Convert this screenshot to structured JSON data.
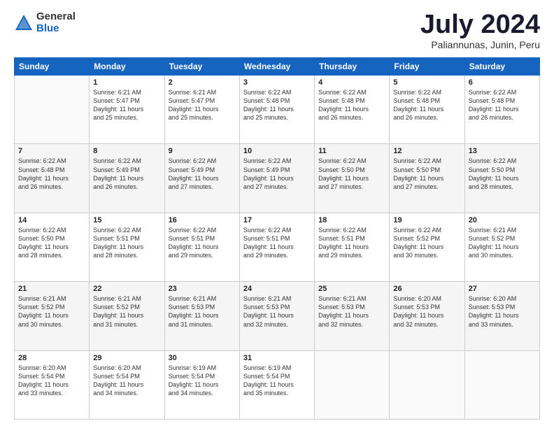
{
  "header": {
    "logo_general": "General",
    "logo_blue": "Blue",
    "month_title": "July 2024",
    "subtitle": "Paliannunas, Junin, Peru"
  },
  "days_of_week": [
    "Sunday",
    "Monday",
    "Tuesday",
    "Wednesday",
    "Thursday",
    "Friday",
    "Saturday"
  ],
  "weeks": [
    [
      {
        "day": "",
        "info": ""
      },
      {
        "day": "1",
        "info": "Sunrise: 6:21 AM\nSunset: 5:47 PM\nDaylight: 11 hours\nand 25 minutes."
      },
      {
        "day": "2",
        "info": "Sunrise: 6:21 AM\nSunset: 5:47 PM\nDaylight: 11 hours\nand 25 minutes."
      },
      {
        "day": "3",
        "info": "Sunrise: 6:22 AM\nSunset: 5:48 PM\nDaylight: 11 hours\nand 25 minutes."
      },
      {
        "day": "4",
        "info": "Sunrise: 6:22 AM\nSunset: 5:48 PM\nDaylight: 11 hours\nand 26 minutes."
      },
      {
        "day": "5",
        "info": "Sunrise: 6:22 AM\nSunset: 5:48 PM\nDaylight: 11 hours\nand 26 minutes."
      },
      {
        "day": "6",
        "info": "Sunrise: 6:22 AM\nSunset: 5:48 PM\nDaylight: 11 hours\nand 26 minutes."
      }
    ],
    [
      {
        "day": "7",
        "info": "Sunrise: 6:22 AM\nSunset: 5:48 PM\nDaylight: 11 hours\nand 26 minutes."
      },
      {
        "day": "8",
        "info": "Sunrise: 6:22 AM\nSunset: 5:49 PM\nDaylight: 11 hours\nand 26 minutes."
      },
      {
        "day": "9",
        "info": "Sunrise: 6:22 AM\nSunset: 5:49 PM\nDaylight: 11 hours\nand 27 minutes."
      },
      {
        "day": "10",
        "info": "Sunrise: 6:22 AM\nSunset: 5:49 PM\nDaylight: 11 hours\nand 27 minutes."
      },
      {
        "day": "11",
        "info": "Sunrise: 6:22 AM\nSunset: 5:50 PM\nDaylight: 11 hours\nand 27 minutes."
      },
      {
        "day": "12",
        "info": "Sunrise: 6:22 AM\nSunset: 5:50 PM\nDaylight: 11 hours\nand 27 minutes."
      },
      {
        "day": "13",
        "info": "Sunrise: 6:22 AM\nSunset: 5:50 PM\nDaylight: 11 hours\nand 28 minutes."
      }
    ],
    [
      {
        "day": "14",
        "info": "Sunrise: 6:22 AM\nSunset: 5:50 PM\nDaylight: 11 hours\nand 28 minutes."
      },
      {
        "day": "15",
        "info": "Sunrise: 6:22 AM\nSunset: 5:51 PM\nDaylight: 11 hours\nand 28 minutes."
      },
      {
        "day": "16",
        "info": "Sunrise: 6:22 AM\nSunset: 5:51 PM\nDaylight: 11 hours\nand 29 minutes."
      },
      {
        "day": "17",
        "info": "Sunrise: 6:22 AM\nSunset: 5:51 PM\nDaylight: 11 hours\nand 29 minutes."
      },
      {
        "day": "18",
        "info": "Sunrise: 6:22 AM\nSunset: 5:51 PM\nDaylight: 11 hours\nand 29 minutes."
      },
      {
        "day": "19",
        "info": "Sunrise: 6:22 AM\nSunset: 5:52 PM\nDaylight: 11 hours\nand 30 minutes."
      },
      {
        "day": "20",
        "info": "Sunrise: 6:21 AM\nSunset: 5:52 PM\nDaylight: 11 hours\nand 30 minutes."
      }
    ],
    [
      {
        "day": "21",
        "info": "Sunrise: 6:21 AM\nSunset: 5:52 PM\nDaylight: 11 hours\nand 30 minutes."
      },
      {
        "day": "22",
        "info": "Sunrise: 6:21 AM\nSunset: 5:52 PM\nDaylight: 11 hours\nand 31 minutes."
      },
      {
        "day": "23",
        "info": "Sunrise: 6:21 AM\nSunset: 5:53 PM\nDaylight: 11 hours\nand 31 minutes."
      },
      {
        "day": "24",
        "info": "Sunrise: 6:21 AM\nSunset: 5:53 PM\nDaylight: 11 hours\nand 32 minutes."
      },
      {
        "day": "25",
        "info": "Sunrise: 6:21 AM\nSunset: 5:53 PM\nDaylight: 11 hours\nand 32 minutes."
      },
      {
        "day": "26",
        "info": "Sunrise: 6:20 AM\nSunset: 5:53 PM\nDaylight: 11 hours\nand 32 minutes."
      },
      {
        "day": "27",
        "info": "Sunrise: 6:20 AM\nSunset: 5:53 PM\nDaylight: 11 hours\nand 33 minutes."
      }
    ],
    [
      {
        "day": "28",
        "info": "Sunrise: 6:20 AM\nSunset: 5:54 PM\nDaylight: 11 hours\nand 33 minutes."
      },
      {
        "day": "29",
        "info": "Sunrise: 6:20 AM\nSunset: 5:54 PM\nDaylight: 11 hours\nand 34 minutes."
      },
      {
        "day": "30",
        "info": "Sunrise: 6:19 AM\nSunset: 5:54 PM\nDaylight: 11 hours\nand 34 minutes."
      },
      {
        "day": "31",
        "info": "Sunrise: 6:19 AM\nSunset: 5:54 PM\nDaylight: 11 hours\nand 35 minutes."
      },
      {
        "day": "",
        "info": ""
      },
      {
        "day": "",
        "info": ""
      },
      {
        "day": "",
        "info": ""
      }
    ]
  ]
}
